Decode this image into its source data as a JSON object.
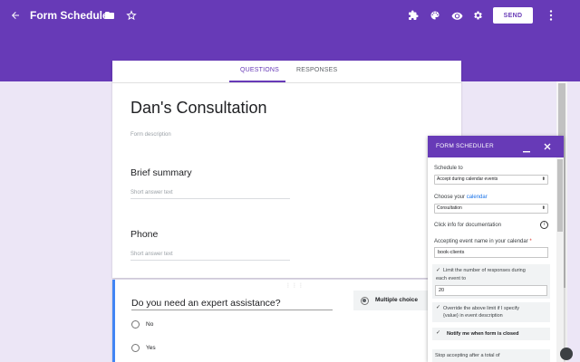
{
  "app": {
    "title": "Form Scheduler",
    "send_label": "SEND"
  },
  "tabs": [
    {
      "label": "QUESTIONS",
      "active": true
    },
    {
      "label": "RESPONSES",
      "active": false
    }
  ],
  "form": {
    "title": "Dan's Consultation",
    "description_placeholder": "Form description",
    "questions": [
      {
        "label": "Brief summary",
        "hint": "Short answer text"
      },
      {
        "label": "Phone",
        "hint": "Short answer text"
      }
    ],
    "active_question": {
      "label": "Do you need an expert assistance?",
      "type": "Multiple choice",
      "options": [
        "No",
        "Yes"
      ]
    }
  },
  "panel": {
    "title": "FORM SCHEDULER",
    "schedule_label": "Schedule to",
    "schedule_value": "Accept during calendar events",
    "calendar_label_prefix": "Choose your ",
    "calendar_link": "calendar",
    "calendar_value": "Consultation",
    "docs_label": "Click info for documentation",
    "event_label": "Accepting event name in your calendar",
    "event_required": "*",
    "event_value": "book-clients",
    "limit_label_1": "Limit the number of responses during",
    "limit_label_2": "each event to",
    "limit_value": "20",
    "override_label_1": "Override the above limit if I specify",
    "override_label_2": "{value} in event description",
    "notify_label": "Notify me when form is closed",
    "stop_label": "Stop accepting after a total of"
  },
  "colors": {
    "brand": "#673ab7",
    "focus": "#4285f4",
    "link": "#1a73e8"
  }
}
